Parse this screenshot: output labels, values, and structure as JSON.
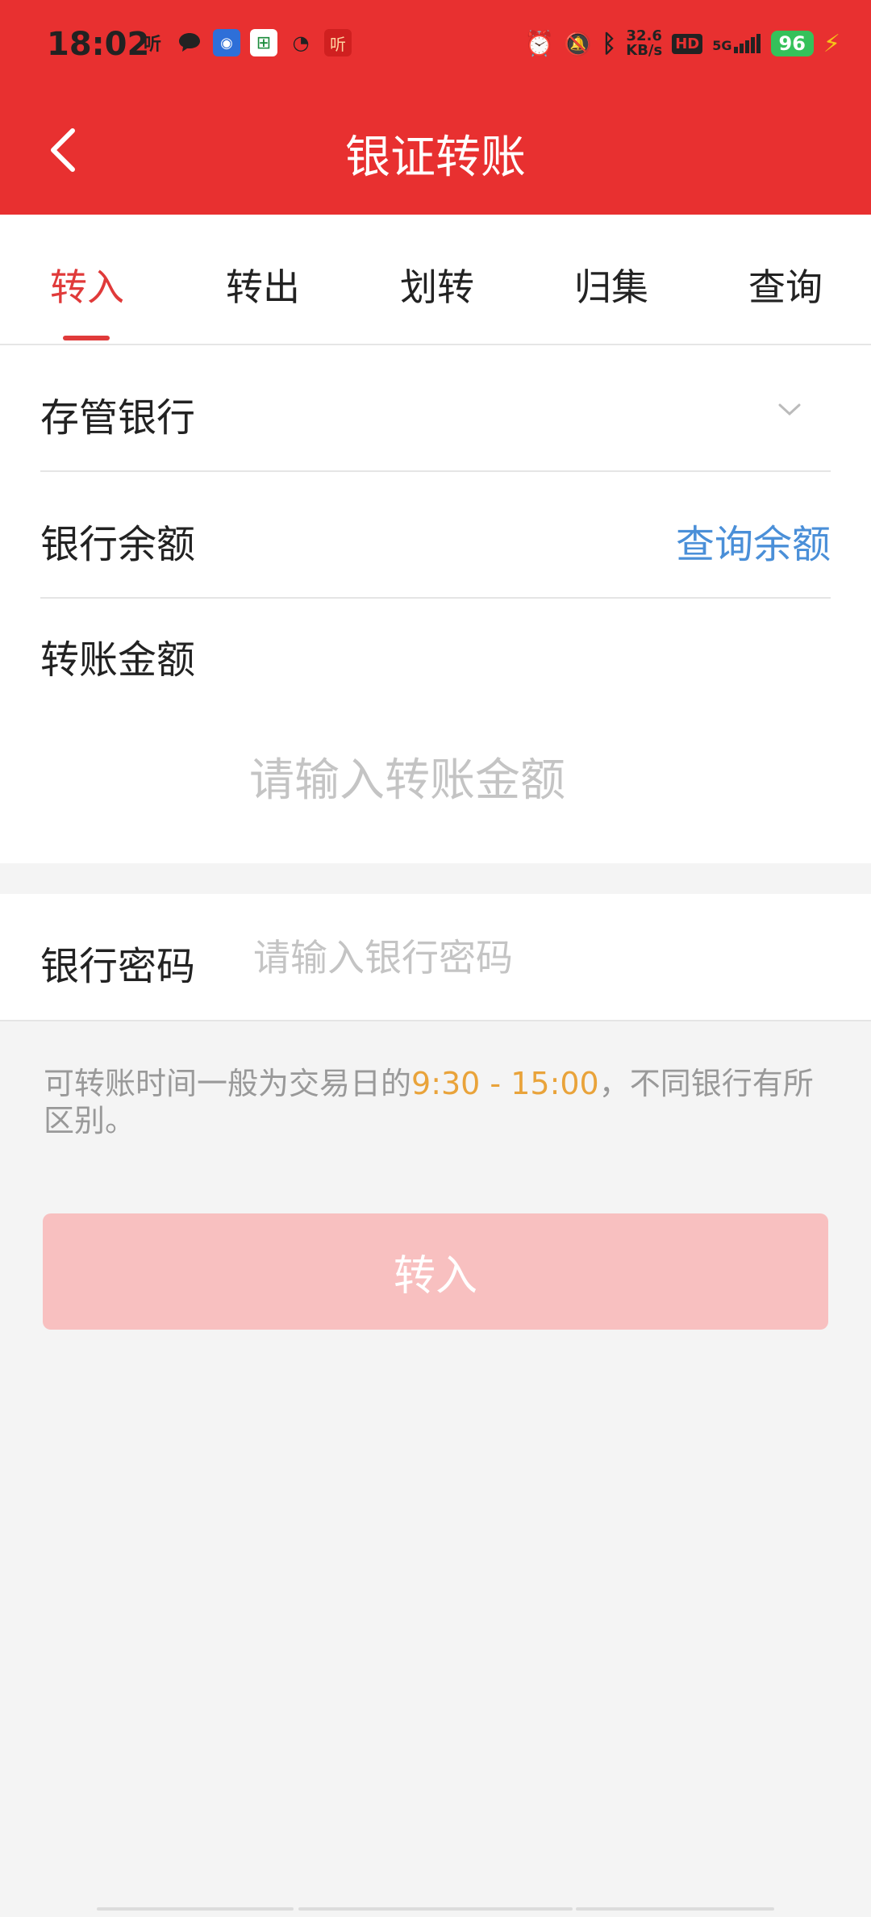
{
  "status_bar": {
    "time": "18:02",
    "left_icons": [
      "listen-icon",
      "chat-bubble-icon",
      "app-blue-icon",
      "post-green-icon",
      "weibo-icon",
      "listen-red-icon"
    ],
    "speed_value": "32.6",
    "speed_unit": "KB/s",
    "hd_label": "HD",
    "network_label": "5G",
    "battery": "96"
  },
  "header": {
    "title": "银证转账"
  },
  "tabs": [
    {
      "label": "转入"
    },
    {
      "label": "转出"
    },
    {
      "label": "划转"
    },
    {
      "label": "归集"
    },
    {
      "label": "查询"
    }
  ],
  "form": {
    "bank_label": "存管银行",
    "balance_label": "银行余额",
    "balance_action": "查询余额",
    "amount_label": "转账金额",
    "amount_placeholder": "请输入转账金额",
    "password_label": "银行密码",
    "password_placeholder": "请输入银行密码"
  },
  "note": {
    "prefix": "可转账时间一般为交易日的",
    "time_range": "9:30 - 15:00",
    "suffix": "，不同银行有所区别。"
  },
  "submit_button": {
    "label": "转入"
  },
  "colors": {
    "brand_red": "#e83030",
    "link_blue": "#4a8fd8",
    "highlight_orange": "#e9a33a",
    "button_disabled": "#f8c0c0"
  }
}
